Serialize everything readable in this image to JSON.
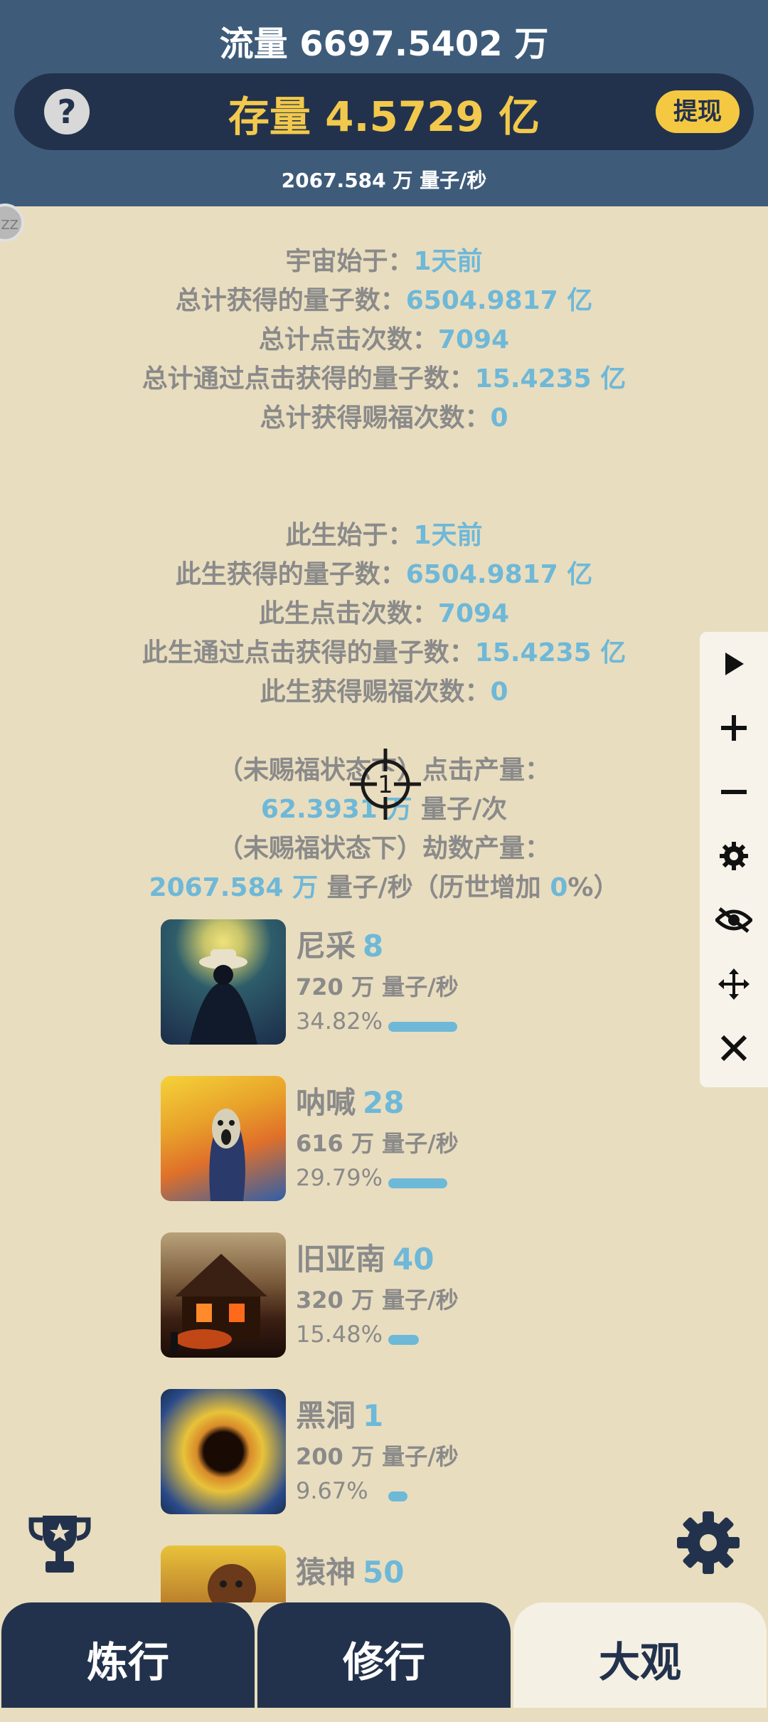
{
  "header": {
    "flow": "流量 6697.5402 万",
    "help_icon": "question-icon",
    "stock": "存量 4.5729 亿",
    "withdraw": "提现",
    "rate": "2067.584 万  量子/秒"
  },
  "side_badge": "ZZ",
  "stats": {
    "universe": {
      "label": "宇宙始于：",
      "value": "1天前"
    },
    "total_quanta": {
      "label": "总计获得的量子数：",
      "value": "6504.9817 亿"
    },
    "total_clicks": {
      "label": "总计点击次数：",
      "value": "7094"
    },
    "total_click_quanta": {
      "label": "总计通过点击获得的量子数：",
      "value": "15.4235 亿"
    },
    "total_blessings": {
      "label": "总计获得赐福次数：",
      "value": "0"
    },
    "life": {
      "label": "此生始于：",
      "value": "1天前"
    },
    "life_quanta": {
      "label": "此生获得的量子数：",
      "value": "6504.9817 亿"
    },
    "life_clicks": {
      "label": "此生点击次数：",
      "value": "7094"
    },
    "life_click_quanta": {
      "label": "此生通过点击获得的量子数：",
      "value": "15.4235 亿"
    },
    "life_blessings": {
      "label": "此生获得赐福次数：",
      "value": "0"
    },
    "click_output_label": "（未赐福状态下）点击产量：",
    "click_output_value": "62.3931 万",
    "click_output_unit": " 量子/次",
    "kalpa_output_label": "（未赐福状态下）劫数产量：",
    "kalpa_output_value": "2067.584 万",
    "kalpa_output_unit": " 量子/秒（历世增加 ",
    "kalpa_bonus": "0",
    "kalpa_bonus_suffix": "%）"
  },
  "crosshair_number": "1",
  "generators": [
    {
      "name": "尼采",
      "level": "8",
      "production": "720 万 量子/秒",
      "percent": "34.82%",
      "share": 0.3482
    },
    {
      "name": "呐喊",
      "level": "28",
      "production": "616 万 量子/秒",
      "percent": "29.79%",
      "share": 0.2979
    },
    {
      "name": "旧亚南",
      "level": "40",
      "production": "320 万 量子/秒",
      "percent": "15.48%",
      "share": 0.1548
    },
    {
      "name": "黑洞",
      "level": "1",
      "production": "200 万 量子/秒",
      "percent": "9.67%",
      "share": 0.0967
    },
    {
      "name": "猿神",
      "level": "50",
      "production": "",
      "percent": "",
      "share": 0
    }
  ],
  "panel_icons": [
    "play-icon",
    "plus-icon",
    "minus-icon",
    "gear-icon",
    "eye-off-icon",
    "move-icon",
    "close-icon"
  ],
  "tabs": [
    {
      "label": "炼行",
      "active": false
    },
    {
      "label": "修行",
      "active": false
    },
    {
      "label": "大观",
      "active": true
    }
  ],
  "colors": {
    "header": "#3e5c7a",
    "dark": "#23324c",
    "gold": "#f2c94c",
    "accent": "#6eb8d8",
    "background": "#e9ddbf"
  }
}
